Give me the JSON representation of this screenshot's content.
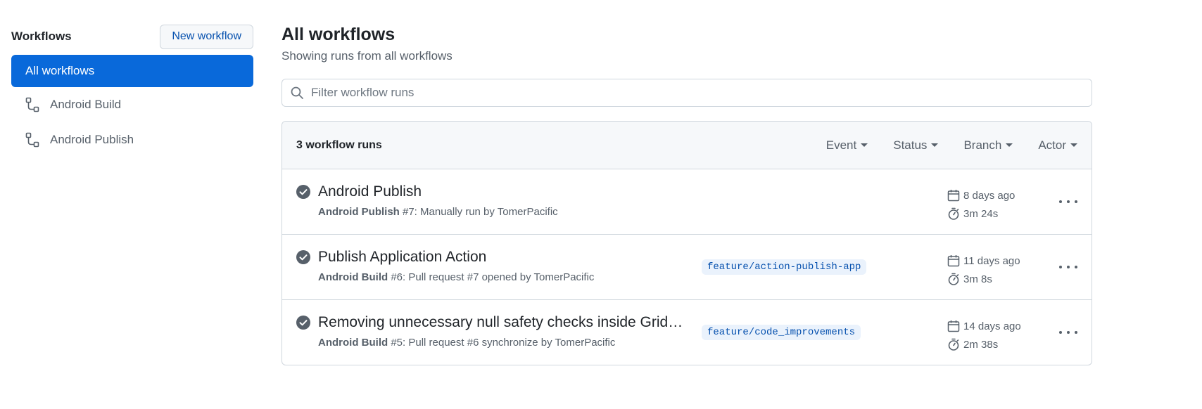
{
  "sidebar": {
    "title": "Workflows",
    "new_workflow_label": "New workflow",
    "active_item": "All workflows",
    "items": [
      {
        "label": "Android Build",
        "icon": "workflow-icon"
      },
      {
        "label": "Android Publish",
        "icon": "workflow-icon"
      }
    ]
  },
  "main": {
    "title": "All workflows",
    "subtitle": "Showing runs from all workflows",
    "search_placeholder": "Filter workflow runs",
    "runs_count": "3 workflow runs",
    "filters": [
      "Event",
      "Status",
      "Branch",
      "Actor"
    ],
    "runs": [
      {
        "title": "Android Publish",
        "workflow": "Android Publish",
        "detail": " #7: Manually run by TomerPacific",
        "branch": "",
        "when": "8 days ago",
        "duration": "3m 24s",
        "status": "success"
      },
      {
        "title": "Publish Application Action",
        "workflow": "Android Build",
        "detail": " #6: Pull request #7 opened by TomerPacific",
        "branch": "feature/action-publish-app",
        "when": "11 days ago",
        "duration": "3m 8s",
        "status": "success"
      },
      {
        "title": "Removing unnecessary null safety checks inside GridVi...",
        "workflow": "Android Build",
        "detail": " #5: Pull request #6 synchronize by TomerPacific",
        "branch": "feature/code_improvements",
        "when": "14 days ago",
        "duration": "2m 38s",
        "status": "success"
      }
    ]
  },
  "colors": {
    "accent": "#0969da",
    "success_icon": "#57606a",
    "branch_bg": "#eaf2fc",
    "branch_text": "#0550ae"
  }
}
